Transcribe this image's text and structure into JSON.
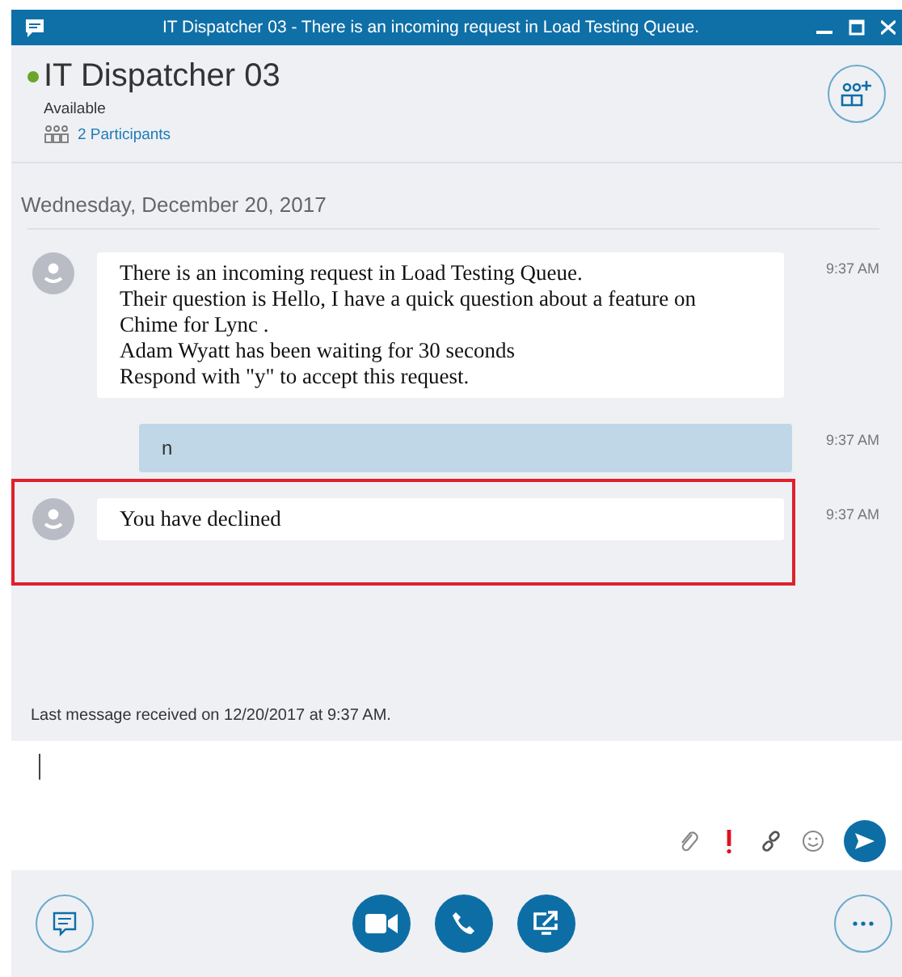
{
  "window": {
    "title": "IT Dispatcher 03 - There is an incoming request in Load Testing Queue."
  },
  "header": {
    "name": "IT Dispatcher 03",
    "status": "Available",
    "participants": "2 Participants"
  },
  "conversation": {
    "date": "Wednesday, December 20, 2017",
    "messages": [
      {
        "kind": "incoming",
        "lines": [
          "There is an incoming request in Load Testing Queue.",
          "Their question is Hello, I have a quick question about a feature on",
          "Chime for Lync .",
          "Adam Wyatt has been waiting for 30 seconds",
          "Respond with \"y\" to accept this request."
        ],
        "time": "9:37 AM",
        "highlighted": false
      },
      {
        "kind": "outgoing",
        "lines": [
          "n"
        ],
        "time": "9:37 AM",
        "highlighted": false
      },
      {
        "kind": "incoming",
        "lines": [
          "You have declined"
        ],
        "time": "9:37 AM",
        "highlighted": true
      }
    ],
    "status_line": "Last message received on 12/20/2017 at 9:37 AM."
  }
}
